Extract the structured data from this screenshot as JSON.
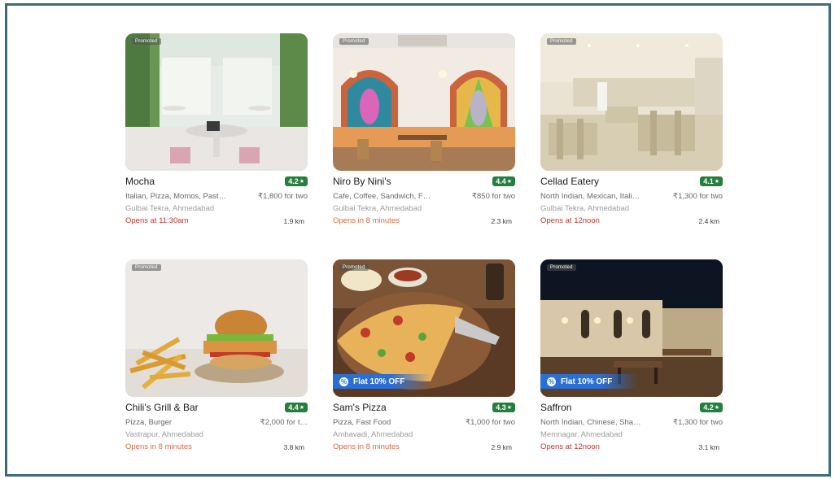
{
  "restaurants": [
    {
      "name": "Mocha",
      "rating": "4.2",
      "cuisine": "Italian, Pizza, Momos, Past…",
      "price": "₹1,800 for two",
      "location": "Gulbai Tekra, Ahmedabad",
      "opens": "Opens at 11:30am",
      "distance": "1.9 km",
      "promoted": "Promoted",
      "offer": ""
    },
    {
      "name": "Niro By Nini's",
      "rating": "4.4",
      "cuisine": "Cafe, Coffee, Sandwich, F…",
      "price": "₹850 for two",
      "location": "Gulbai Tekra, Ahmedabad",
      "opens": "Opens in 8 minutes",
      "distance": "2.3 km",
      "promoted": "Promoted",
      "offer": ""
    },
    {
      "name": "Cellad Eatery",
      "rating": "4.1",
      "cuisine": "North Indian, Mexican, Itali…",
      "price": "₹1,300 for two",
      "location": "Gulbai Tekra, Ahmedabad",
      "opens": "Opens at 12noon",
      "distance": "2.4 km",
      "promoted": "Promoted",
      "offer": ""
    },
    {
      "name": "Chili's Grill & Bar",
      "rating": "4.4",
      "cuisine": "Pizza, Burger",
      "price": "₹2,000 for t…",
      "location": "Vastrapur, Ahmedabad",
      "opens": "Opens in 8 minutes",
      "distance": "3.8 km",
      "promoted": "Promoted",
      "offer": ""
    },
    {
      "name": "Sam's Pizza",
      "rating": "4.3",
      "cuisine": "Pizza, Fast Food",
      "price": "₹1,000 for two",
      "location": "Ambavadi, Ahmedabad",
      "opens": "Opens in 8 minutes",
      "distance": "2.9 km",
      "promoted": "Promoted",
      "offer": "Flat 10% OFF"
    },
    {
      "name": "Saffron",
      "rating": "4.2",
      "cuisine": "North Indian, Chinese, Sha…",
      "price": "₹1,300 for two",
      "location": "Memnagar, Ahmedabad",
      "opens": "Opens at 12noon",
      "distance": "3.1 km",
      "promoted": "Promoted",
      "offer": "Flat 10% OFF"
    }
  ],
  "colors": {
    "rating_green": "#267e3e",
    "offer_blue": "#2b6fd6",
    "frame": "#3e6b7c"
  },
  "icons": {
    "rating": "star-icon",
    "offer": "discount-badge-icon"
  }
}
